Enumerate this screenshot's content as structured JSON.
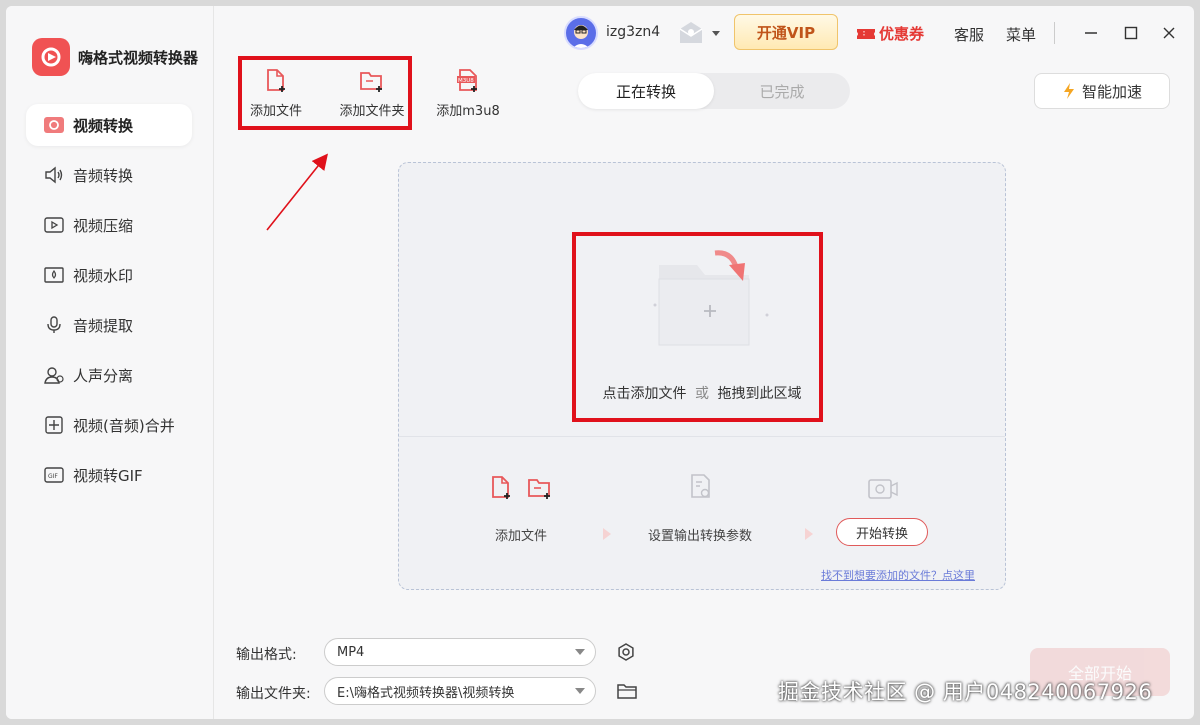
{
  "app": {
    "title": "嗨格式视频转换器",
    "brand_color": "#f05253"
  },
  "sidebar": {
    "items": [
      {
        "label": "视频转换",
        "icon": "video-convert-icon",
        "active": true
      },
      {
        "label": "音频转换",
        "icon": "speaker-icon"
      },
      {
        "label": "视频压缩",
        "icon": "video-compress-icon"
      },
      {
        "label": "视频水印",
        "icon": "watermark-icon"
      },
      {
        "label": "音频提取",
        "icon": "mic-icon"
      },
      {
        "label": "人声分离",
        "icon": "voice-separate-icon"
      },
      {
        "label": "视频(音频)合并",
        "icon": "merge-icon"
      },
      {
        "label": "视频转GIF",
        "icon": "gif-icon"
      }
    ]
  },
  "topbar": {
    "username": "izg3zn4",
    "vip_label": "开通VIP",
    "coupon_label": "优惠券",
    "service_label": "客服",
    "menu_label": "菜单"
  },
  "toolbar": {
    "add_file": "添加文件",
    "add_folder": "添加文件夹",
    "add_m3u8": "添加m3u8",
    "m3u8_badge": "M3U8"
  },
  "tabs": {
    "converting": "正在转换",
    "completed": "已完成"
  },
  "accelerate_label": "智能加速",
  "drop_area": {
    "hint_click": "点击添加文件",
    "hint_or": "或",
    "hint_drag": "拖拽到此区域",
    "step_add": "添加文件",
    "step_settings": "设置输出转换参数",
    "step_start": "开始转换",
    "help_link": "找不到想要添加的文件？点这里"
  },
  "output": {
    "format_label": "输出格式:",
    "format_value": "MP4",
    "folder_label": "输出文件夹:",
    "folder_value": "E:\\嗨格式视频转换器\\视频转换"
  },
  "start_all_label": "全部开始",
  "watermark": "掘金技术社区 @ 用户048240067926",
  "colors": {
    "accent": "#e0111b",
    "icon_red": "#e8585a"
  }
}
